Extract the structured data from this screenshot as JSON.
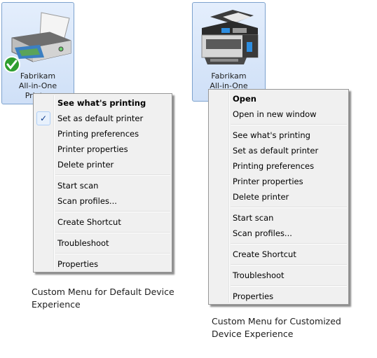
{
  "left": {
    "device_name_line1": "Fabrikam",
    "device_name_line2": "All-in-One",
    "device_name_line3": "Printer",
    "icon": "printer-icon",
    "status_icon": "default-checkmark-icon",
    "menu": {
      "items": [
        {
          "label": "See what's printing",
          "bold": true
        },
        {
          "label": "Set as default printer",
          "checked": true
        },
        {
          "label": "Printing preferences"
        },
        {
          "label": "Printer properties"
        },
        {
          "label": "Delete printer"
        },
        {
          "label": "Start scan"
        },
        {
          "label": "Scan profiles..."
        },
        {
          "label": "Create Shortcut"
        },
        {
          "label": "Troubleshoot"
        },
        {
          "label": "Properties"
        }
      ]
    },
    "caption_line1": "Custom Menu for Default Device",
    "caption_line2": "Experience"
  },
  "right": {
    "device_name_line1": "Fabrikam",
    "device_name_line2": "All-in-One",
    "icon": "multifunction-printer-icon",
    "menu": {
      "items": [
        {
          "label": "Open",
          "bold": true
        },
        {
          "label": "Open in new window"
        },
        {
          "label": "See what's printing"
        },
        {
          "label": "Set as default printer"
        },
        {
          "label": "Printing preferences"
        },
        {
          "label": "Printer properties"
        },
        {
          "label": "Delete printer"
        },
        {
          "label": "Start scan"
        },
        {
          "label": "Scan profiles..."
        },
        {
          "label": "Create Shortcut"
        },
        {
          "label": "Troubleshoot"
        },
        {
          "label": "Properties"
        }
      ]
    },
    "caption_line1": "Custom Menu for Customized",
    "caption_line2": "Device Experience"
  },
  "check_glyph": "✓"
}
